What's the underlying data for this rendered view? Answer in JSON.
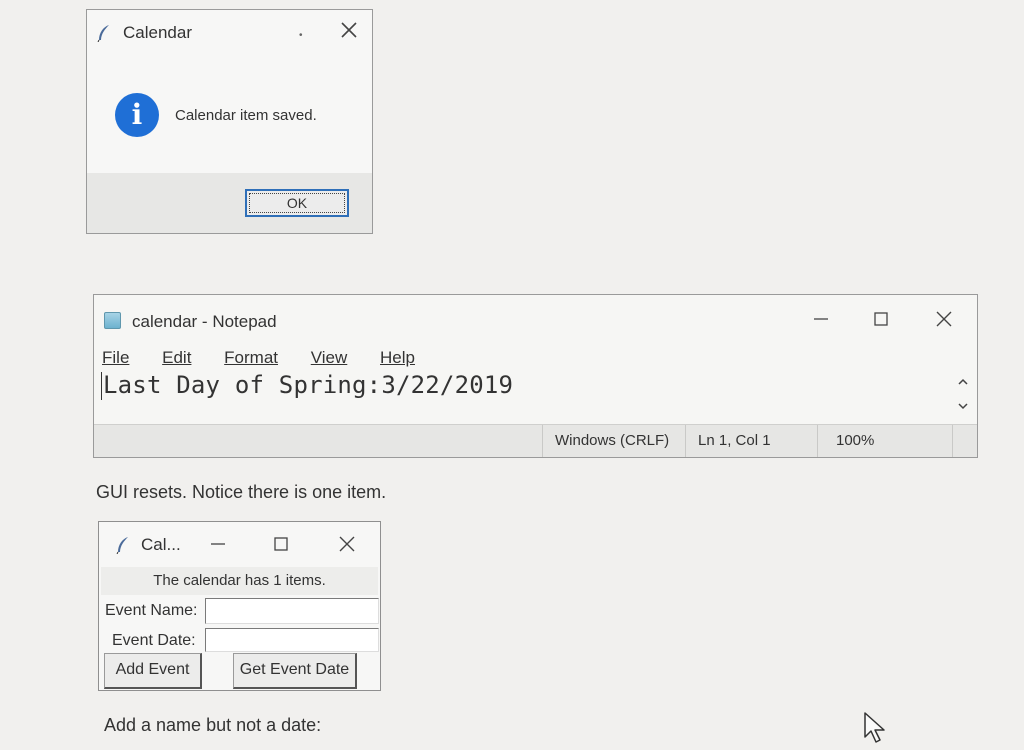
{
  "message_box": {
    "title": "Calendar",
    "message": "Calendar item saved.",
    "ok_label": "OK",
    "icon": "info-icon",
    "accent_color": "#1f6fd6"
  },
  "notepad": {
    "title": "calendar - Notepad",
    "menu": [
      "File",
      "Edit",
      "Format",
      "View",
      "Help"
    ],
    "content": "Last Day of Spring:3/22/2019",
    "status": {
      "line_ending": "Windows (CRLF)",
      "position": "Ln 1, Col 1",
      "zoom": "100%"
    }
  },
  "caption1": "GUI resets. Notice there is one item.",
  "calendar_gui": {
    "title": "Cal...",
    "count_text": "The calendar has 1 items.",
    "event_name_label": "Event Name:",
    "event_name_value": "",
    "event_date_label": "Event Date:",
    "event_date_value": "",
    "add_button": "Add Event",
    "get_button": "Get Event Date"
  },
  "caption2": "Add a name but not a date:"
}
